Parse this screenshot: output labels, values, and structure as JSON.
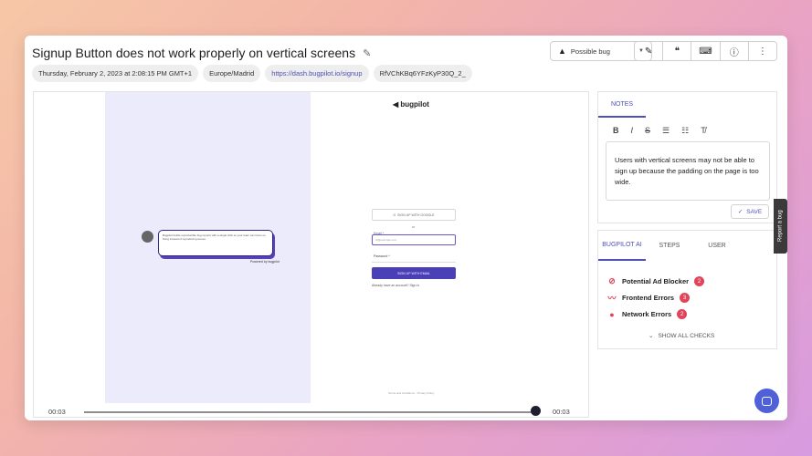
{
  "header": {
    "title": "Signup Button does not work properly on vertical screens",
    "chips": [
      "Thursday, February 2, 2023 at 2:08:15 PM GMT+1",
      "Europe/Madrid",
      "https://dash.bugpilot.io/signup",
      "RfVChKBq6YFzKyP30Q_2_"
    ],
    "bug_type": "Possible bug"
  },
  "player": {
    "logo": "bugpilot",
    "google": "SIGN UP WITH GOOGLE",
    "or": "or",
    "email_label": "Email *",
    "email_placeholder": "hi@example.com",
    "password_label": "Password *",
    "submit": "SIGN UP WITH EMAIL",
    "have_account": "Already have an account? Sign in",
    "speech": "Bugpilot builds reproducible bug reports with a single click so your team can focus on fixing instead of reproducing issues.",
    "speech_tag": "Powered by bugpilot",
    "footer": "Terms and Conditions · Privacy Policy",
    "time_start": "00:03",
    "time_end": "00:03"
  },
  "notes": {
    "tab": "NOTES",
    "text": "Users with vertical screens may not be able to sign up because the padding on the page is too wide.",
    "save": "SAVE"
  },
  "checks": {
    "tabs": [
      "BUGPILOT AI",
      "STEPS",
      "USER"
    ],
    "items": [
      {
        "label": "Potential Ad Blocker",
        "count": "2"
      },
      {
        "label": "Frontend Errors",
        "count": "3"
      },
      {
        "label": "Network Errors",
        "count": "2"
      }
    ],
    "show_all": "SHOW ALL CHECKS"
  },
  "report_tab": "Report a bug",
  "colors": {
    "accent": "#4c52b8",
    "error": "#e0455a",
    "chat": "#4f60d8"
  }
}
